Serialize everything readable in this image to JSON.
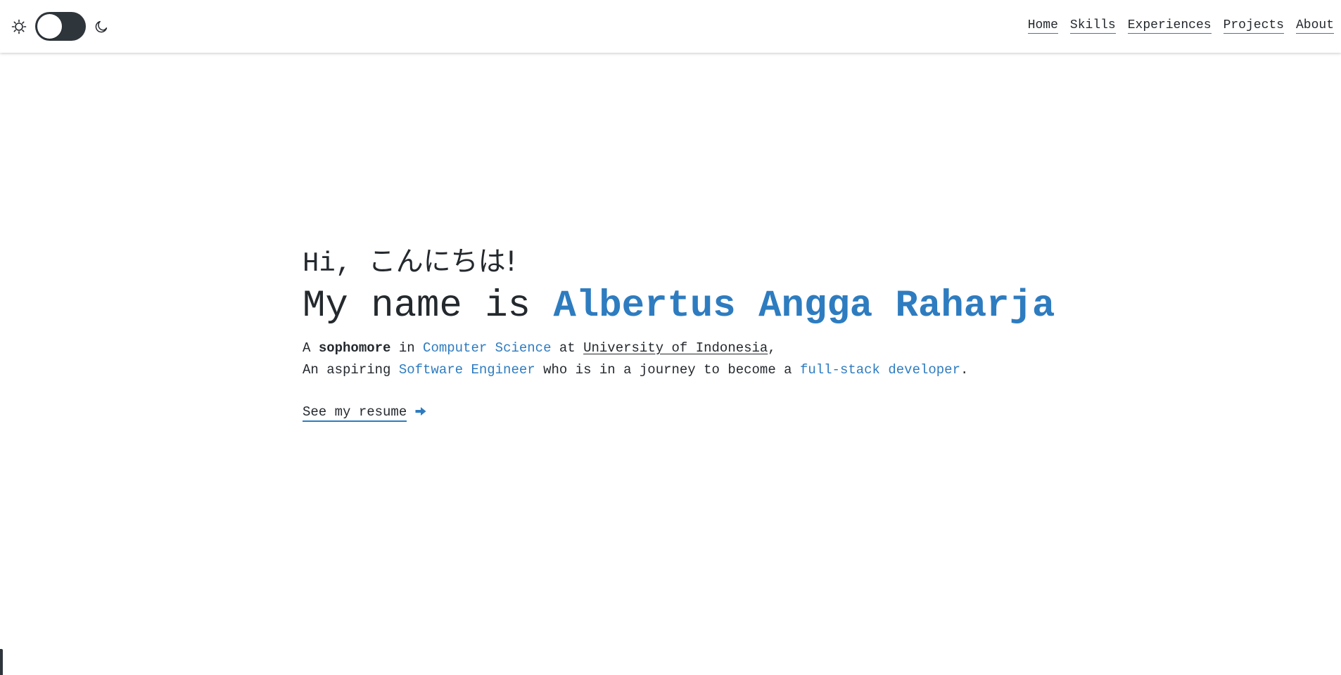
{
  "nav": {
    "theme": {
      "light_icon": "sun-icon",
      "dark_icon": "moon-icon",
      "mode": "light"
    },
    "links": [
      {
        "label": "Home"
      },
      {
        "label": "Skills"
      },
      {
        "label": "Experiences"
      },
      {
        "label": "Projects"
      },
      {
        "label": "About"
      }
    ]
  },
  "hero": {
    "greeting_en": "Hi, ",
    "greeting_jp": "こんにちは!",
    "headline_prefix": "My name is ",
    "name": "Albertus Angga Raharja",
    "line1": {
      "a": "A ",
      "year": "sophomore",
      "in": " in ",
      "major": "Computer Science",
      "at": " at ",
      "university": "University of Indonesia",
      "end": ","
    },
    "line2": {
      "a": "An aspiring ",
      "role": "Software Engineer",
      "mid": " who is in a journey to become a ",
      "goal": "full-stack developer",
      "end": "."
    },
    "resume": {
      "label": "See my resume",
      "icon": "arrow-right-icon"
    }
  },
  "colors": {
    "accent": "#2e7cc0",
    "text": "#24292e",
    "toggle_bg": "#2e353b"
  }
}
